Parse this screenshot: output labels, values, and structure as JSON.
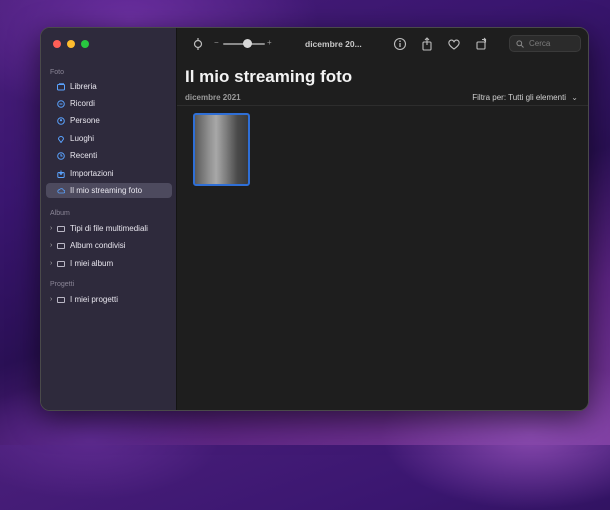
{
  "window": {
    "title": "dicembre 20..."
  },
  "search": {
    "placeholder": "Cerca"
  },
  "sidebar": {
    "sections": [
      {
        "label": "Foto",
        "items": [
          {
            "label": "Libreria",
            "icon": "library-icon"
          },
          {
            "label": "Ricordi",
            "icon": "memories-icon"
          },
          {
            "label": "Persone",
            "icon": "people-icon"
          },
          {
            "label": "Luoghi",
            "icon": "places-icon"
          },
          {
            "label": "Recenti",
            "icon": "recents-icon"
          },
          {
            "label": "Importazioni",
            "icon": "imports-icon"
          },
          {
            "label": "Il mio streaming foto",
            "icon": "cloud-icon",
            "selected": true
          }
        ]
      },
      {
        "label": "Album",
        "items": [
          {
            "label": "Tipi di file multimediali",
            "icon": "folder-icon"
          },
          {
            "label": "Album condivisi",
            "icon": "folder-icon"
          },
          {
            "label": "I miei album",
            "icon": "folder-icon"
          }
        ]
      },
      {
        "label": "Progetti",
        "items": [
          {
            "label": "I miei progetti",
            "icon": "folder-icon"
          }
        ]
      }
    ]
  },
  "toolbar": {
    "zoom_minus": "−",
    "zoom_plus": "+"
  },
  "main": {
    "title": "Il mio streaming foto",
    "date": "dicembre 2021",
    "filter": "Filtra per: Tutti gli elementi"
  },
  "colors": {
    "accent": "#2f6fd6",
    "sidebar": "#2e2a3c",
    "selected": "#4d4a5e"
  }
}
